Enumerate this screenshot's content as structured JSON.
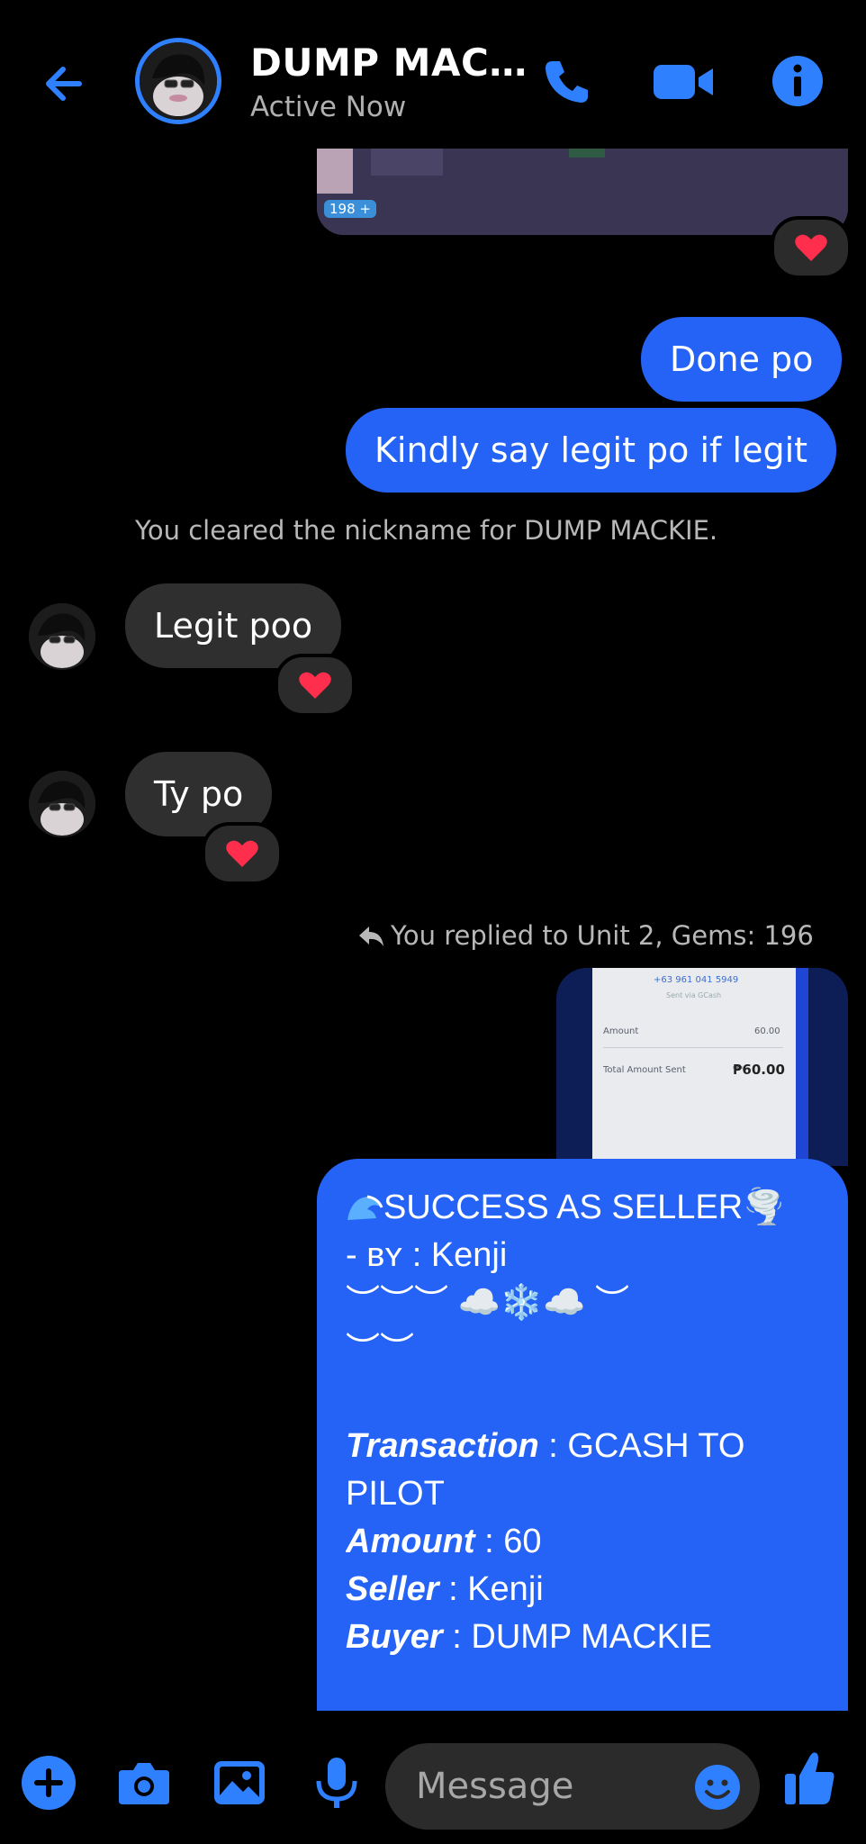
{
  "header": {
    "contact_name": "DUMP MAC…",
    "status": "Active Now",
    "icons": [
      "back-arrow-icon",
      "phone-icon",
      "video-camera-icon",
      "info-icon"
    ],
    "accent_color": "#2f80ff"
  },
  "image_preview": {
    "gems": "198"
  },
  "messages": {
    "outgoing_1": "Done po",
    "outgoing_2": "Kindly say legit po if legit",
    "system_nickname": "You cleared the nickname for DUMP MACKIE.",
    "incoming_1": "Legit poo",
    "incoming_2": "Ty po",
    "reply_notice": "You replied to Unit 2, Gems: 196"
  },
  "receipt": {
    "phone": "+63 961 041 5949",
    "subtext": "Sent via GCash",
    "amount_label": "Amount",
    "amount_value": "60.00",
    "total_label": "Total Amount Sent",
    "total_value": "₱60.00"
  },
  "big_message": {
    "line1": "SUCCESS AS SELLER🌪️",
    "line2": "- ʙʏ : Kenji",
    "line3": "︶︶︶ ☁️❄️☁️ ︶",
    "line4": "︶︶",
    "transaction_label": "Transaction",
    "transaction_value": " : GCASH TO",
    "transaction_value2": "PILOT",
    "amount_label": "Amount",
    "amount_value": " : 60",
    "seller_label": "Seller",
    "seller_value": " : Kenji",
    "buyer_label": "Buyer",
    "buyer_value": " : DUMP MACKIE"
  },
  "composer": {
    "placeholder": "Message",
    "icons": [
      "plus-icon",
      "camera-icon",
      "gallery-icon",
      "microphone-icon",
      "emoji-icon",
      "thumbs-up-icon"
    ]
  },
  "colors": {
    "outgoing_bubble": "#2563f6",
    "incoming_bubble": "#2f2f2f",
    "reaction": "#ff2e4d"
  }
}
